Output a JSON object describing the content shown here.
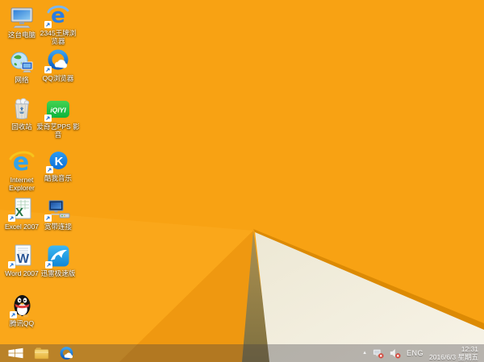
{
  "colors": {
    "wallpaper_base": "#F8A213",
    "wallpaper_fold_light": "#FAA71A",
    "wallpaper_fold_dark": "#EF9810",
    "wallpaper_olive": "#A58D4D",
    "wallpaper_cream": "#F3EEE0",
    "wallpaper_stripe": "#DC8A04",
    "taskbar_overlay": "rgba(62,60,66,0.34)",
    "label_text": "#FFFFFF"
  },
  "desktop": {
    "icons": [
      {
        "id": "this-pc",
        "label": "这台电脑",
        "icon": "computer-icon",
        "shortcut": false
      },
      {
        "id": "2345",
        "label": "2345王牌浏\n览器",
        "icon": "blue-e-browser-icon",
        "shortcut": true
      },
      {
        "id": "network",
        "label": "网络",
        "icon": "network-globe-icon",
        "shortcut": false
      },
      {
        "id": "qq-browser",
        "label": "QQ浏览器",
        "icon": "blue-ring-cloud-icon",
        "shortcut": true
      },
      {
        "id": "recycle",
        "label": "回收站",
        "icon": "recycle-bin-icon",
        "shortcut": false
      },
      {
        "id": "iqiyi",
        "label": "爱奇艺PPS 影\n音",
        "icon": "iqiyi-green-icon",
        "shortcut": true
      },
      {
        "id": "ie",
        "label": "Internet\nExplorer",
        "icon": "internet-explorer-icon",
        "shortcut": false
      },
      {
        "id": "kuwo",
        "label": "酷我音乐",
        "icon": "kuwo-k-circle-icon",
        "shortcut": true
      },
      {
        "id": "excel",
        "label": "Excel 2007",
        "icon": "excel-icon",
        "shortcut": true
      },
      {
        "id": "broadband",
        "label": "宽带连接",
        "icon": "broadband-connection-icon",
        "shortcut": true
      },
      {
        "id": "word",
        "label": "Word 2007",
        "icon": "word-icon",
        "shortcut": true
      },
      {
        "id": "thunder",
        "label": "迅雷极速版",
        "icon": "thunder-bird-icon",
        "shortcut": true
      },
      {
        "id": "qq",
        "label": "腾讯QQ",
        "icon": "qq-penguin-icon",
        "shortcut": true
      }
    ]
  },
  "taskbar": {
    "buttons": [
      {
        "id": "start",
        "icon": "windows-start-icon"
      },
      {
        "id": "explorer",
        "icon": "file-explorer-icon"
      },
      {
        "id": "qq-browser",
        "icon": "qq-browser-icon"
      }
    ],
    "tray": {
      "hidden_icons_glyph": "▲",
      "network_status_icon": "network-disconnected-icon",
      "volume_status_icon": "volume-muted-icon",
      "language": "ENG",
      "time": "12:31",
      "date": "2016/6/3 星期五"
    }
  }
}
